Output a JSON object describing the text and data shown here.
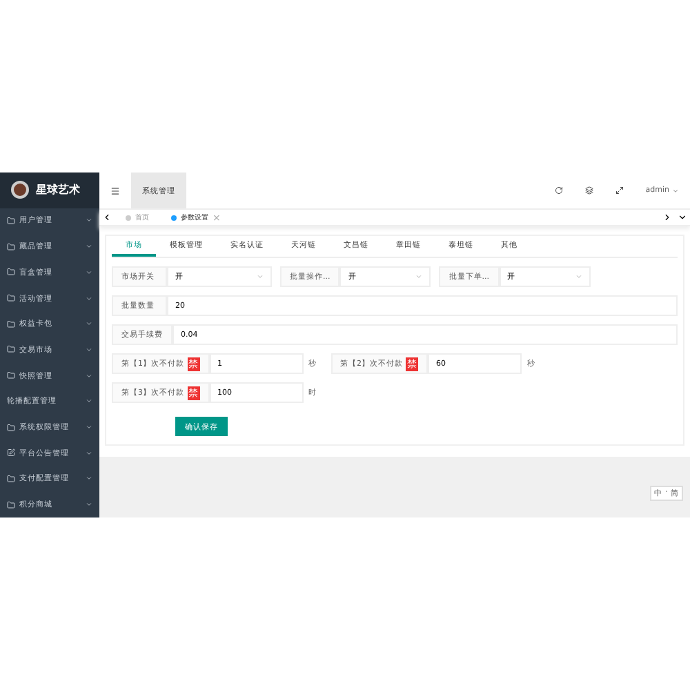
{
  "logo": {
    "title": "星球艺术"
  },
  "sidebar": {
    "items": [
      {
        "label": "用户管理",
        "icon": true
      },
      {
        "label": "藏品管理",
        "icon": true
      },
      {
        "label": "盲盒管理",
        "icon": true
      },
      {
        "label": "活动管理",
        "icon": true
      },
      {
        "label": "权益卡包",
        "icon": true
      },
      {
        "label": "交易市场",
        "icon": true
      },
      {
        "label": "快照管理",
        "icon": true
      },
      {
        "label": "轮播配置管理",
        "icon": false
      },
      {
        "label": "系统权限管理",
        "icon": true
      },
      {
        "label": "平台公告管理",
        "icon": true
      },
      {
        "label": "支付配置管理",
        "icon": true
      },
      {
        "label": "积分商城",
        "icon": true
      }
    ]
  },
  "header": {
    "tab": "系统管理",
    "user": "admin"
  },
  "page_tabs": [
    {
      "label": "首页",
      "selected": false
    },
    {
      "label": "参数设置",
      "selected": true,
      "close": "×"
    }
  ],
  "tabs": [
    {
      "label": "市场",
      "selected": true
    },
    {
      "label": "模板管理",
      "selected": false
    },
    {
      "label": "实名认证",
      "selected": false
    },
    {
      "label": "天河链",
      "selected": false
    },
    {
      "label": "文昌链",
      "selected": false
    },
    {
      "label": "章田链",
      "selected": false
    },
    {
      "label": "泰坦链",
      "selected": false
    },
    {
      "label": "其他",
      "selected": false
    }
  ],
  "selects": [
    {
      "label": "市场开关",
      "value": "开"
    },
    {
      "label": "批量操作...",
      "value": "开"
    },
    {
      "label": "批量下单...",
      "value": "开"
    }
  ],
  "fields": [
    {
      "label": "批量数量",
      "value": "20"
    },
    {
      "label": "交易手续费",
      "value": "0.04"
    }
  ],
  "penalties": [
    {
      "label": "第【1】次不付款",
      "badge": "禁",
      "value": "1",
      "unit": "秒"
    },
    {
      "label": "第【2】次不付款",
      "badge": "禁",
      "value": "60",
      "unit": "秒"
    },
    {
      "label": "第【3】次不付款",
      "badge": "禁",
      "value": "100",
      "unit": "时"
    }
  ],
  "save_button": "确认保存",
  "ime": [
    "中",
    "·",
    "简"
  ]
}
